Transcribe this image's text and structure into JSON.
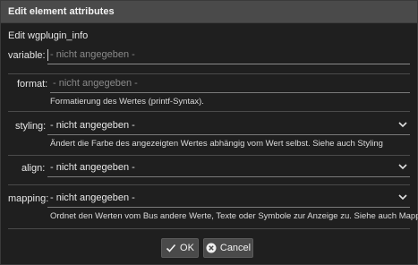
{
  "window": {
    "title": "Edit element attributes"
  },
  "heading": "Edit wgplugin_info",
  "fields": {
    "variable": {
      "label": "variable:",
      "placeholder": "- nicht angegeben -"
    },
    "format": {
      "label": "format:",
      "placeholder": "- nicht angegeben -",
      "hint": "Formatierung des Wertes (printf-Syntax)."
    },
    "styling": {
      "label": "styling:",
      "value": "- nicht angegeben -",
      "hint": "Ändert die Farbe des angezeigten Wertes abhängig vom Wert selbst. Siehe auch Styling"
    },
    "align": {
      "label": "align:",
      "value": "- nicht angegeben -"
    },
    "mapping": {
      "label": "mapping:",
      "value": "- nicht angegeben -",
      "hint": "Ordnet den Werten vom Bus andere Werte, Texte oder Symbole zur Anzeige zu. Siehe auch Mapping"
    }
  },
  "buttons": {
    "ok": "OK",
    "cancel": "Cancel"
  },
  "icons": {
    "dropdown": "chevron-down-icon",
    "ok": "checkmark-icon",
    "cancel": "close-circle-icon"
  }
}
